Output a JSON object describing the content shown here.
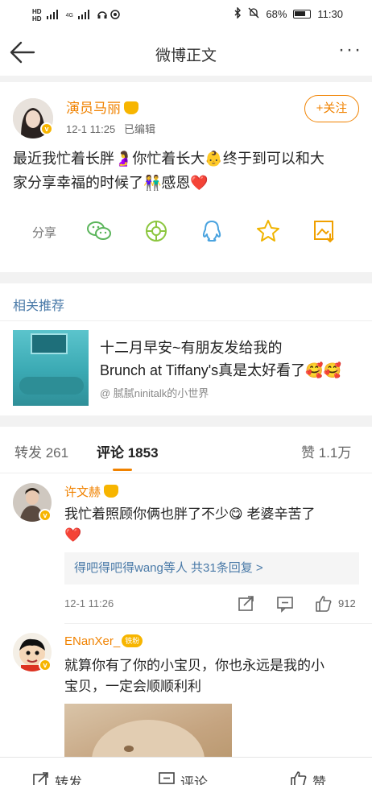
{
  "status_bar": {
    "left_tags": [
      "HD",
      "HD"
    ],
    "networks": [
      "4G",
      "4G"
    ],
    "battery_percent": "68%",
    "time": "11:30"
  },
  "nav": {
    "title": "微博正文",
    "more": "···"
  },
  "post": {
    "author": "演员马丽",
    "timestamp": "12-1 11:25",
    "edited": "已编辑",
    "follow_label": "+关注",
    "text_line1": "最近我忙着长胖🤰你忙着长大👶终于到可以和大",
    "text_line2": "家分享幸福的时候了👫感恩❤️",
    "share_label": "分享",
    "share_icons": [
      "wechat-icon",
      "moments-icon",
      "qq-icon",
      "qzone-star-icon",
      "save-image-icon"
    ]
  },
  "related": {
    "header": "相关推荐",
    "title_line1": "十二月早安~有朋友发给我的",
    "title_line2": "Brunch at Tiffany's真是太好看了🥰🥰",
    "source": "@ 腻腻ninitalk的小世界"
  },
  "tabs": {
    "repost": "转发 261",
    "comments": "评论 1853",
    "likes": "赞 1.1万"
  },
  "comments": [
    {
      "name": "许文赫",
      "text_line1": "我忙着照顾你俩也胖了不少😋 老婆辛苦了",
      "text_line2": "❤️",
      "reply_summary": "得吧得吧得wang等人 共31条回复 >",
      "time": "12-1 11:26",
      "likes": "912"
    },
    {
      "name": "ENanXer_",
      "vip": "铁粉",
      "text_line1": "就算你有了你的小宝贝，你也永远是我的小",
      "text_line2": "宝贝，一定会顺顺利利"
    }
  ],
  "bottom_bar": {
    "repost": "转发",
    "comment": "评论",
    "like": "赞"
  },
  "colors": {
    "accent": "#f08200",
    "link": "#4a7aa8",
    "vip_gold": "#f7b500"
  }
}
